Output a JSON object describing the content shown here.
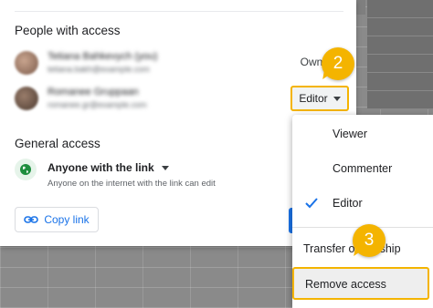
{
  "people_section": {
    "title": "People with access",
    "people": [
      {
        "name": "Tetiana Bahkevych (you)",
        "email": "tetiana.bakh@example.com",
        "role": "Owner"
      },
      {
        "name": "Romanee Gruppaan",
        "email": "romanee.gr@example.com",
        "role": "Editor"
      }
    ]
  },
  "general_access": {
    "title": "General access",
    "selected": "Anyone with the link",
    "description": "Anyone on the internet with the link can edit",
    "copy_link_label": "Copy link"
  },
  "role_menu": {
    "options": [
      {
        "label": "Viewer",
        "selected": false
      },
      {
        "label": "Commenter",
        "selected": false
      },
      {
        "label": "Editor",
        "selected": true
      }
    ],
    "transfer_label": "Transfer ownership",
    "remove_label": "Remove access"
  },
  "callouts": {
    "step_2": "2",
    "step_3": "3"
  },
  "colors": {
    "accent": "#1a73e8",
    "callout": "#f4b400",
    "globe": "#1e8e3e"
  }
}
